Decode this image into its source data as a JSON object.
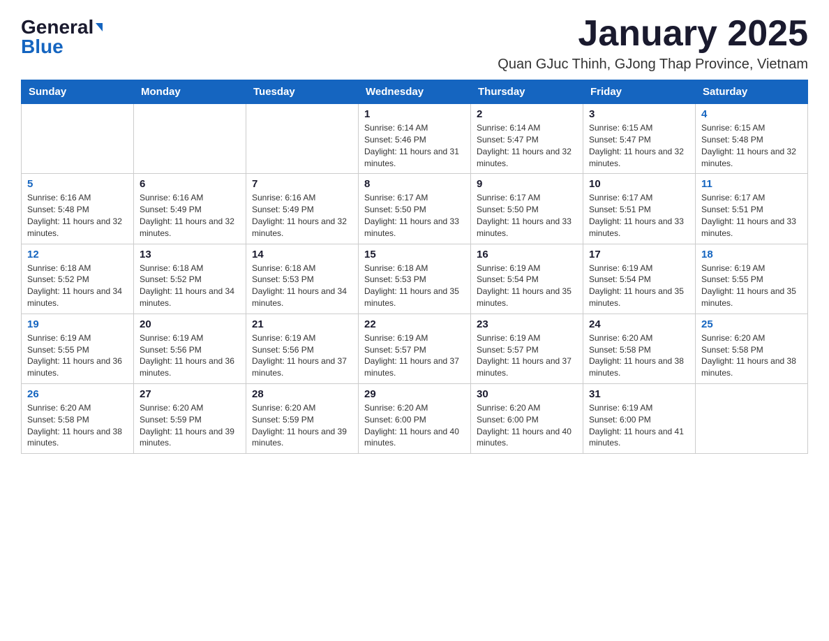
{
  "header": {
    "logo_general": "General",
    "logo_blue": "Blue",
    "month_title": "January 2025",
    "location": "Quan GJuc Thinh, GJong Thap Province, Vietnam"
  },
  "weekdays": [
    "Sunday",
    "Monday",
    "Tuesday",
    "Wednesday",
    "Thursday",
    "Friday",
    "Saturday"
  ],
  "weeks": [
    [
      {
        "day": "",
        "info": ""
      },
      {
        "day": "",
        "info": ""
      },
      {
        "day": "",
        "info": ""
      },
      {
        "day": "1",
        "info": "Sunrise: 6:14 AM\nSunset: 5:46 PM\nDaylight: 11 hours and 31 minutes."
      },
      {
        "day": "2",
        "info": "Sunrise: 6:14 AM\nSunset: 5:47 PM\nDaylight: 11 hours and 32 minutes."
      },
      {
        "day": "3",
        "info": "Sunrise: 6:15 AM\nSunset: 5:47 PM\nDaylight: 11 hours and 32 minutes."
      },
      {
        "day": "4",
        "info": "Sunrise: 6:15 AM\nSunset: 5:48 PM\nDaylight: 11 hours and 32 minutes."
      }
    ],
    [
      {
        "day": "5",
        "info": "Sunrise: 6:16 AM\nSunset: 5:48 PM\nDaylight: 11 hours and 32 minutes."
      },
      {
        "day": "6",
        "info": "Sunrise: 6:16 AM\nSunset: 5:49 PM\nDaylight: 11 hours and 32 minutes."
      },
      {
        "day": "7",
        "info": "Sunrise: 6:16 AM\nSunset: 5:49 PM\nDaylight: 11 hours and 32 minutes."
      },
      {
        "day": "8",
        "info": "Sunrise: 6:17 AM\nSunset: 5:50 PM\nDaylight: 11 hours and 33 minutes."
      },
      {
        "day": "9",
        "info": "Sunrise: 6:17 AM\nSunset: 5:50 PM\nDaylight: 11 hours and 33 minutes."
      },
      {
        "day": "10",
        "info": "Sunrise: 6:17 AM\nSunset: 5:51 PM\nDaylight: 11 hours and 33 minutes."
      },
      {
        "day": "11",
        "info": "Sunrise: 6:17 AM\nSunset: 5:51 PM\nDaylight: 11 hours and 33 minutes."
      }
    ],
    [
      {
        "day": "12",
        "info": "Sunrise: 6:18 AM\nSunset: 5:52 PM\nDaylight: 11 hours and 34 minutes."
      },
      {
        "day": "13",
        "info": "Sunrise: 6:18 AM\nSunset: 5:52 PM\nDaylight: 11 hours and 34 minutes."
      },
      {
        "day": "14",
        "info": "Sunrise: 6:18 AM\nSunset: 5:53 PM\nDaylight: 11 hours and 34 minutes."
      },
      {
        "day": "15",
        "info": "Sunrise: 6:18 AM\nSunset: 5:53 PM\nDaylight: 11 hours and 35 minutes."
      },
      {
        "day": "16",
        "info": "Sunrise: 6:19 AM\nSunset: 5:54 PM\nDaylight: 11 hours and 35 minutes."
      },
      {
        "day": "17",
        "info": "Sunrise: 6:19 AM\nSunset: 5:54 PM\nDaylight: 11 hours and 35 minutes."
      },
      {
        "day": "18",
        "info": "Sunrise: 6:19 AM\nSunset: 5:55 PM\nDaylight: 11 hours and 35 minutes."
      }
    ],
    [
      {
        "day": "19",
        "info": "Sunrise: 6:19 AM\nSunset: 5:55 PM\nDaylight: 11 hours and 36 minutes."
      },
      {
        "day": "20",
        "info": "Sunrise: 6:19 AM\nSunset: 5:56 PM\nDaylight: 11 hours and 36 minutes."
      },
      {
        "day": "21",
        "info": "Sunrise: 6:19 AM\nSunset: 5:56 PM\nDaylight: 11 hours and 37 minutes."
      },
      {
        "day": "22",
        "info": "Sunrise: 6:19 AM\nSunset: 5:57 PM\nDaylight: 11 hours and 37 minutes."
      },
      {
        "day": "23",
        "info": "Sunrise: 6:19 AM\nSunset: 5:57 PM\nDaylight: 11 hours and 37 minutes."
      },
      {
        "day": "24",
        "info": "Sunrise: 6:20 AM\nSunset: 5:58 PM\nDaylight: 11 hours and 38 minutes."
      },
      {
        "day": "25",
        "info": "Sunrise: 6:20 AM\nSunset: 5:58 PM\nDaylight: 11 hours and 38 minutes."
      }
    ],
    [
      {
        "day": "26",
        "info": "Sunrise: 6:20 AM\nSunset: 5:58 PM\nDaylight: 11 hours and 38 minutes."
      },
      {
        "day": "27",
        "info": "Sunrise: 6:20 AM\nSunset: 5:59 PM\nDaylight: 11 hours and 39 minutes."
      },
      {
        "day": "28",
        "info": "Sunrise: 6:20 AM\nSunset: 5:59 PM\nDaylight: 11 hours and 39 minutes."
      },
      {
        "day": "29",
        "info": "Sunrise: 6:20 AM\nSunset: 6:00 PM\nDaylight: 11 hours and 40 minutes."
      },
      {
        "day": "30",
        "info": "Sunrise: 6:20 AM\nSunset: 6:00 PM\nDaylight: 11 hours and 40 minutes."
      },
      {
        "day": "31",
        "info": "Sunrise: 6:19 AM\nSunset: 6:00 PM\nDaylight: 11 hours and 41 minutes."
      },
      {
        "day": "",
        "info": ""
      }
    ]
  ]
}
